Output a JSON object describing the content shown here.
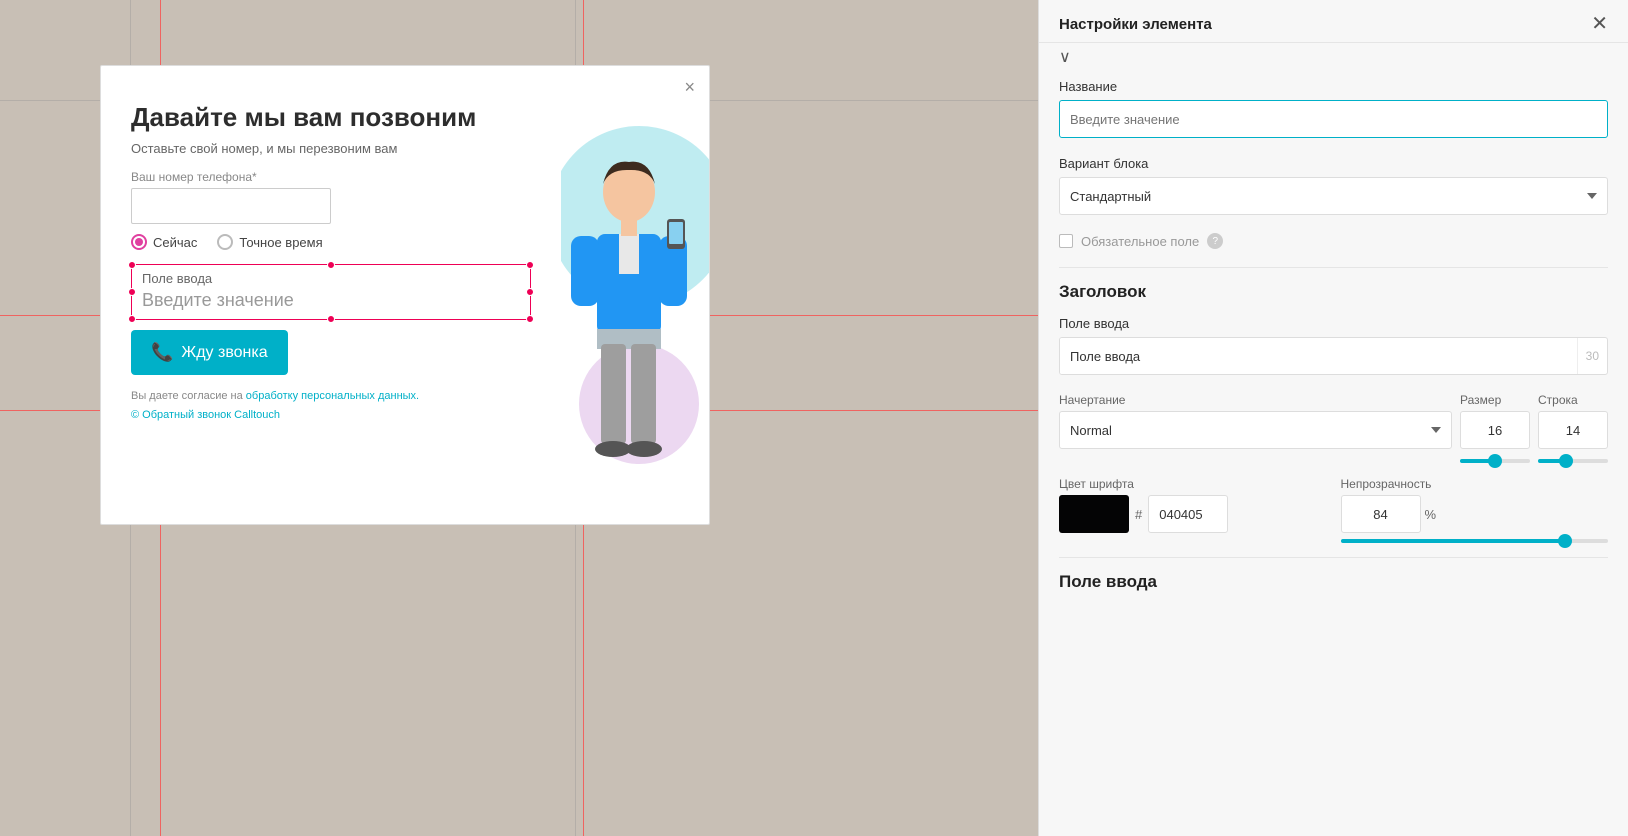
{
  "canvas": {
    "background_color": "#c8bfb5"
  },
  "modal": {
    "title": "Давайте мы вам позвоним",
    "subtitle": "Оставьте свой номер, и мы перезвоним вам",
    "phone_label": "Ваш номер телефона*",
    "phone_placeholder": "",
    "radio_now": "Сейчас",
    "radio_exact": "Точное время",
    "field_label": "Поле ввода",
    "field_placeholder": "Введите значение",
    "cta_button": "Жду звонка",
    "consent_text": "Вы даете согласие на ",
    "consent_link": "обработку персональных данных.",
    "calltouch_text": "© Обратный звонок Calltouch",
    "close_symbol": "×"
  },
  "settings_panel": {
    "title": "Настройки элемента",
    "close_symbol": "✕",
    "chevron": "∨",
    "name_label": "Название",
    "name_placeholder": "Введите значение",
    "variant_label": "Вариант блока",
    "variant_value": "Стандартный",
    "required_label": "Обязательное поле",
    "heading_section": "Заголовок",
    "heading_field_label": "Поле ввода",
    "heading_field_value": "Поле ввода",
    "heading_field_count": "30",
    "style_label": "Начертание",
    "style_value": "Normal",
    "size_label": "Размер",
    "size_value": "16",
    "line_label": "Строка",
    "line_value": "14",
    "font_color_label": "Цвет шрифта",
    "font_color_hex": "040405",
    "opacity_label": "Непрозрачность",
    "opacity_value": "84",
    "opacity_symbol": "%",
    "input_section": "Поле ввода",
    "size_slider_pct": "50",
    "line_slider_pct": "40",
    "opacity_slider_pct": "84"
  }
}
